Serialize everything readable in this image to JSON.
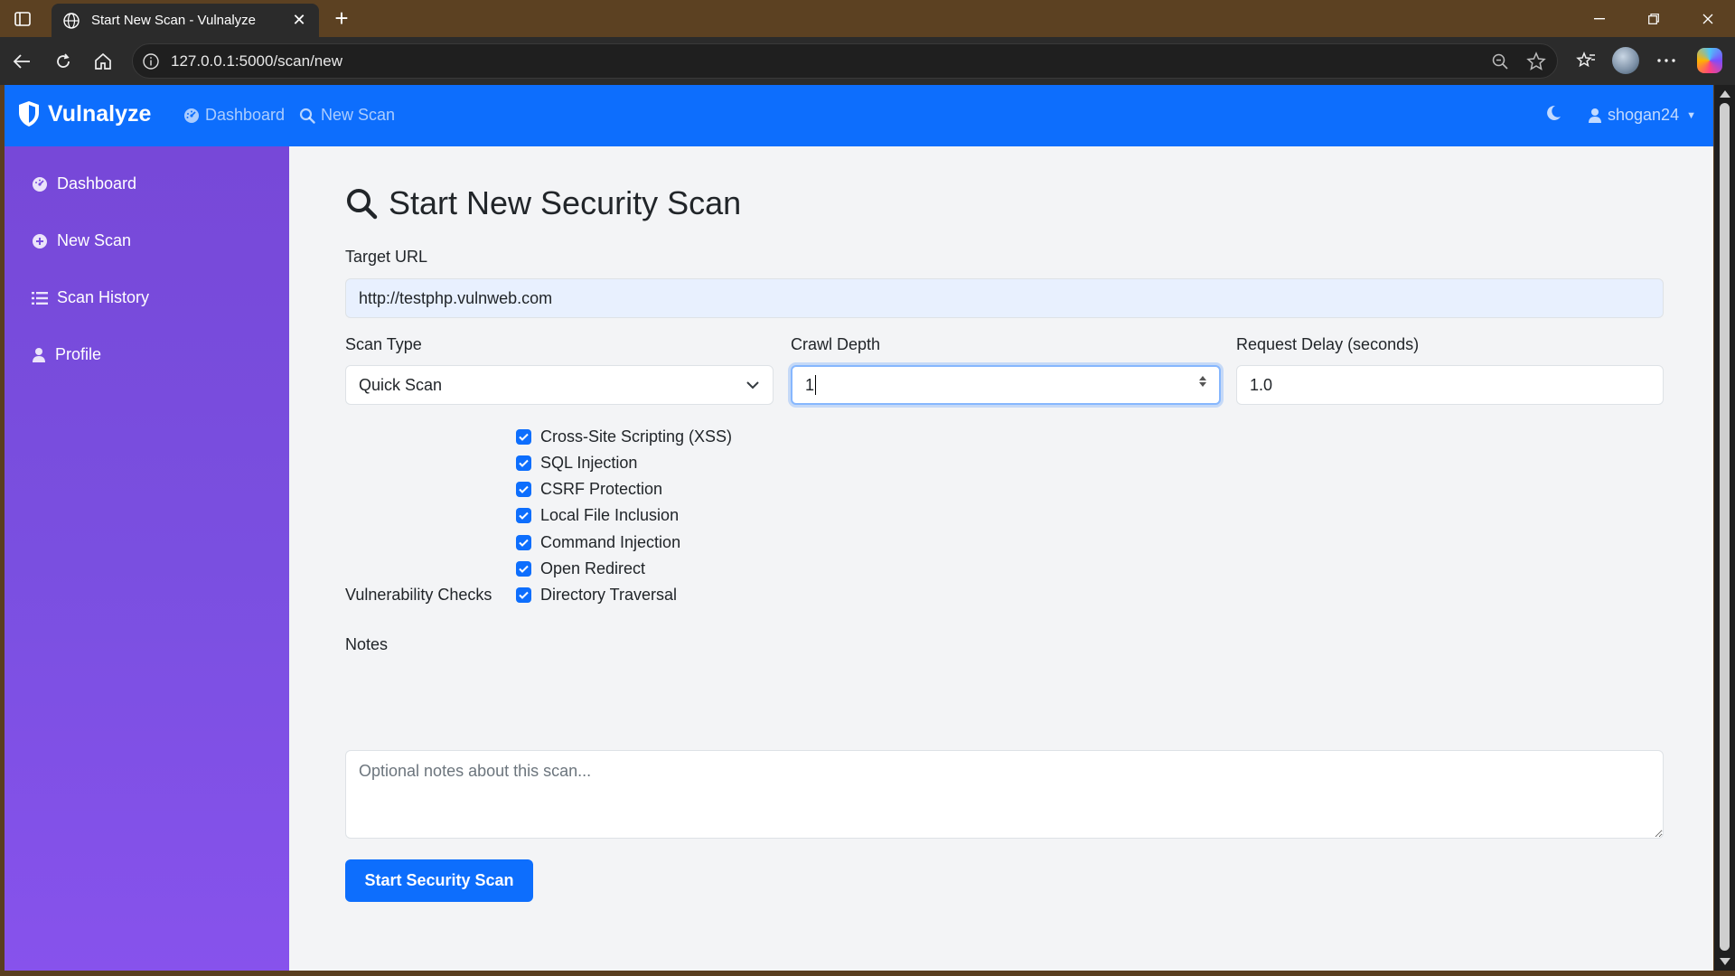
{
  "browser": {
    "tab_title": "Start New Scan - Vulnalyze",
    "url": "127.0.0.1:5000/scan/new"
  },
  "navbar": {
    "brand": "Vulnalyze",
    "links": [
      {
        "label": "Dashboard",
        "icon": "dashboard-icon"
      },
      {
        "label": "New Scan",
        "icon": "search-icon"
      }
    ],
    "user": "shogan24"
  },
  "sidebar": {
    "items": [
      {
        "label": "Dashboard",
        "icon": "dashboard-icon"
      },
      {
        "label": "New Scan",
        "icon": "plus-circle-icon"
      },
      {
        "label": "Scan History",
        "icon": "list-icon"
      },
      {
        "label": "Profile",
        "icon": "user-icon"
      }
    ]
  },
  "form": {
    "title": "Start New Security Scan",
    "target_url_label": "Target URL",
    "target_url_value": "http://testphp.vulnweb.com",
    "scan_type_label": "Scan Type",
    "scan_type_value": "Quick Scan",
    "crawl_depth_label": "Crawl Depth",
    "crawl_depth_value": "1",
    "request_delay_label": "Request Delay (seconds)",
    "request_delay_value": "1.0",
    "vuln_checks_label": "Vulnerability Checks",
    "checks": [
      {
        "label": "Cross-Site Scripting (XSS)",
        "checked": true
      },
      {
        "label": "SQL Injection",
        "checked": true
      },
      {
        "label": "CSRF Protection",
        "checked": true
      },
      {
        "label": "Local File Inclusion",
        "checked": true
      },
      {
        "label": "Command Injection",
        "checked": true
      },
      {
        "label": "Open Redirect",
        "checked": true
      },
      {
        "label": "Directory Traversal",
        "checked": true
      }
    ],
    "notes_label": "Notes",
    "notes_placeholder": "Optional notes about this scan...",
    "submit_label": "Start Security Scan"
  },
  "colors": {
    "primary": "#0d6efd",
    "sidebar_top": "#7748d8",
    "sidebar_bottom": "#8752ec"
  }
}
